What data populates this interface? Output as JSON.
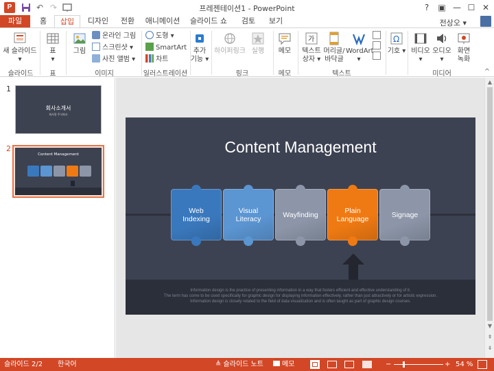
{
  "window": {
    "title": "프레젠테이션1 - PowerPoint",
    "help": "?",
    "ribbon_opts": "▣",
    "minimize": "—",
    "maximize": "☐",
    "close": "✕",
    "user": "전상오 ▾"
  },
  "quick_access": {
    "logo": "P"
  },
  "tabs": [
    "파일",
    "홈",
    "삽입",
    "디자인",
    "전환",
    "애니메이션",
    "슬라이드 쇼",
    "검토",
    "보기"
  ],
  "ribbon": {
    "new_slide": "새 슬라이드",
    "new_slide_arrow": "▾",
    "table": "표",
    "table_arrow": "▾",
    "picture": "그림",
    "online_picture": "온라인 그림",
    "screenshot": "스크린샷 ▾",
    "photo_album": "사진 앨범 ▾",
    "shapes": "도형 ▾",
    "smartart": "SmartArt",
    "chart": "차트",
    "addins": "추가 기능 ▾",
    "hyperlink": "하이퍼링크",
    "action": "실행",
    "comment": "메모",
    "textbox": "텍스트 상자 ▾",
    "header_footer": "머리글/ 바닥글",
    "wordart": "WordArt ▾",
    "symbol": "기호 ▾",
    "video": "비디오 ▾",
    "audio": "오디오 ▾",
    "screen_record": "화면 녹화",
    "groups": [
      "슬라이드",
      "표",
      "이미지",
      "일러스트레이션",
      "링크",
      "메모",
      "텍스트",
      "미디어"
    ]
  },
  "thumbnails": [
    {
      "number": "1",
      "title": "회사소개서",
      "subtitle": "회사명 주식회사"
    },
    {
      "number": "2",
      "title": "Content Management"
    }
  ],
  "slide": {
    "title": "Content Management",
    "pieces": [
      {
        "label": "Web Indexing",
        "color": "#3a78bd"
      },
      {
        "label": "Visual Literacy",
        "color": "#5b95d2"
      },
      {
        "label": "Wayfinding",
        "color": "#8c96a8"
      },
      {
        "label": "Plain Language",
        "color": "#ef7a13"
      },
      {
        "label": "Signage",
        "color": "#8c96a8"
      }
    ],
    "footer": [
      "Information design is the practice of presenting information in a way that fosters efficient and effective understanding of it.",
      "The term has come to be used specifically for graphic design for displaying information effectively, rather than just attractively or for artistic expression.",
      "Information design is closely related to the field of data visualization and is often taught as part of graphic design courses."
    ]
  },
  "status": {
    "slide_pos": "슬라이드 2/2",
    "language": "한국어",
    "notes": "≜ 슬라이드 노트",
    "comments": "메모",
    "zoom_minus": "−",
    "zoom_plus": "+",
    "zoom": "54 %"
  },
  "colors": {
    "accent": "#d24726",
    "slide_bg": "#3d4252"
  }
}
